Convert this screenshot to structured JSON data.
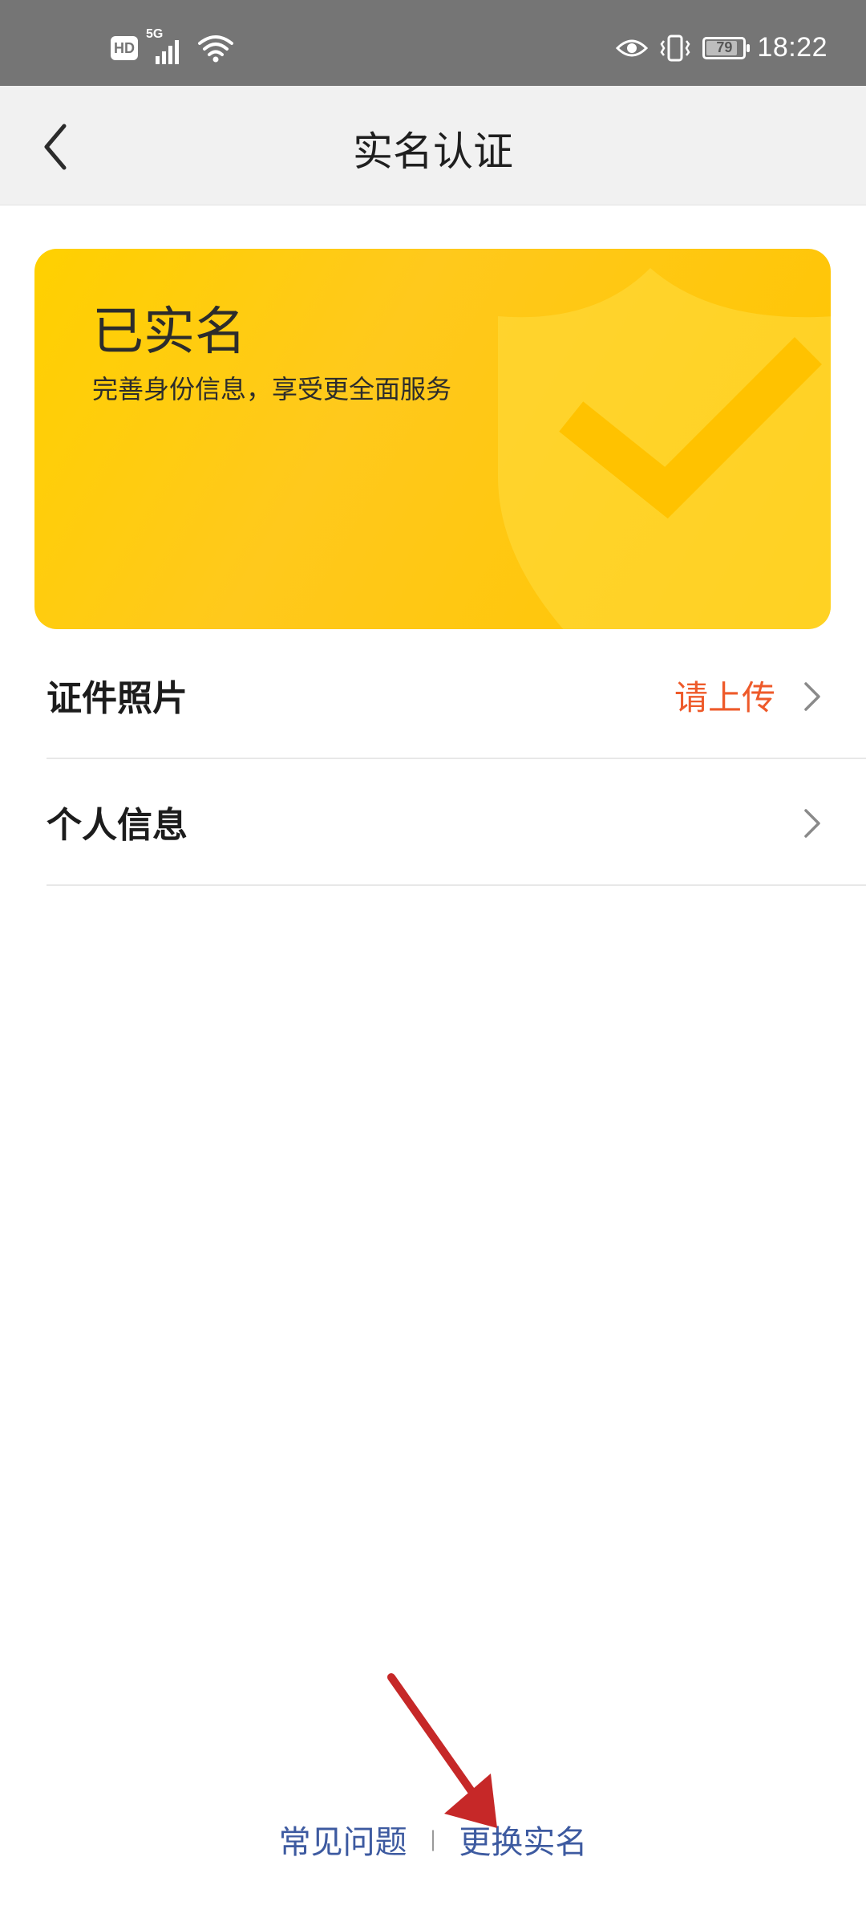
{
  "status_bar": {
    "hd": "HD",
    "network": "5G",
    "battery_level": 79,
    "battery_text": "79",
    "time": "18:22",
    "icons": [
      "hd-icon",
      "signal-5g-icon",
      "wifi-icon",
      "eye-icon",
      "vibrate-icon",
      "battery-icon"
    ]
  },
  "nav": {
    "title": "实名认证",
    "back_icon": "chevron-left-icon"
  },
  "card": {
    "title": "已实名",
    "subtitle": "完善身份信息，享受更全面服务",
    "background": "#ffc91c",
    "icon": "shield-check-icon"
  },
  "list": {
    "items": [
      {
        "label": "证件照片",
        "value": "请上传",
        "value_color": "#ee5a2a"
      },
      {
        "label": "个人信息",
        "value": ""
      }
    ],
    "chevron_icon": "chevron-right-icon"
  },
  "footer": {
    "faq": "常见问题",
    "divider": "|",
    "change_name": "更换实名",
    "link_color": "#3d5aa0"
  },
  "annotation": {
    "icon": "arrow-annotation-icon",
    "color": "#c62828"
  }
}
